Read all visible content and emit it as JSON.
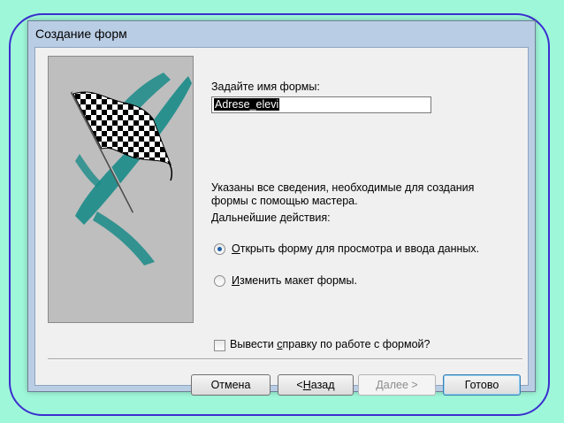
{
  "dialog": {
    "title": "Создание форм",
    "form_name_label": "Задайте имя формы:",
    "form_name_value": "Adrese_elevi",
    "info_line1": "Указаны все сведения, необходимые для создания",
    "info_line2": "формы с помощью мастера.",
    "next_actions_label": "Дальнейшие действия:",
    "options": [
      {
        "pre": "",
        "u": "О",
        "post": "ткрыть форму для просмотра и ввода данных.",
        "checked": true
      },
      {
        "pre": "",
        "u": "И",
        "post": "зменить макет формы.",
        "checked": false
      }
    ],
    "help_checkbox": {
      "pre": "Вывести ",
      "u": "с",
      "post": "правку по работе с формой?",
      "checked": false
    },
    "buttons": {
      "cancel": "Отмена",
      "back_pre": "< ",
      "back_u": "Н",
      "back_post": "азад",
      "next": "Далее >",
      "finish": "Готово"
    }
  },
  "colors": {
    "background": "#9ff7d9",
    "frame": "#3b2fd0",
    "radio_dot": "#1e5fa8",
    "teal_brush": "#1a8b88"
  },
  "icons": {
    "wizard_image": "checkered-flag-icon"
  }
}
